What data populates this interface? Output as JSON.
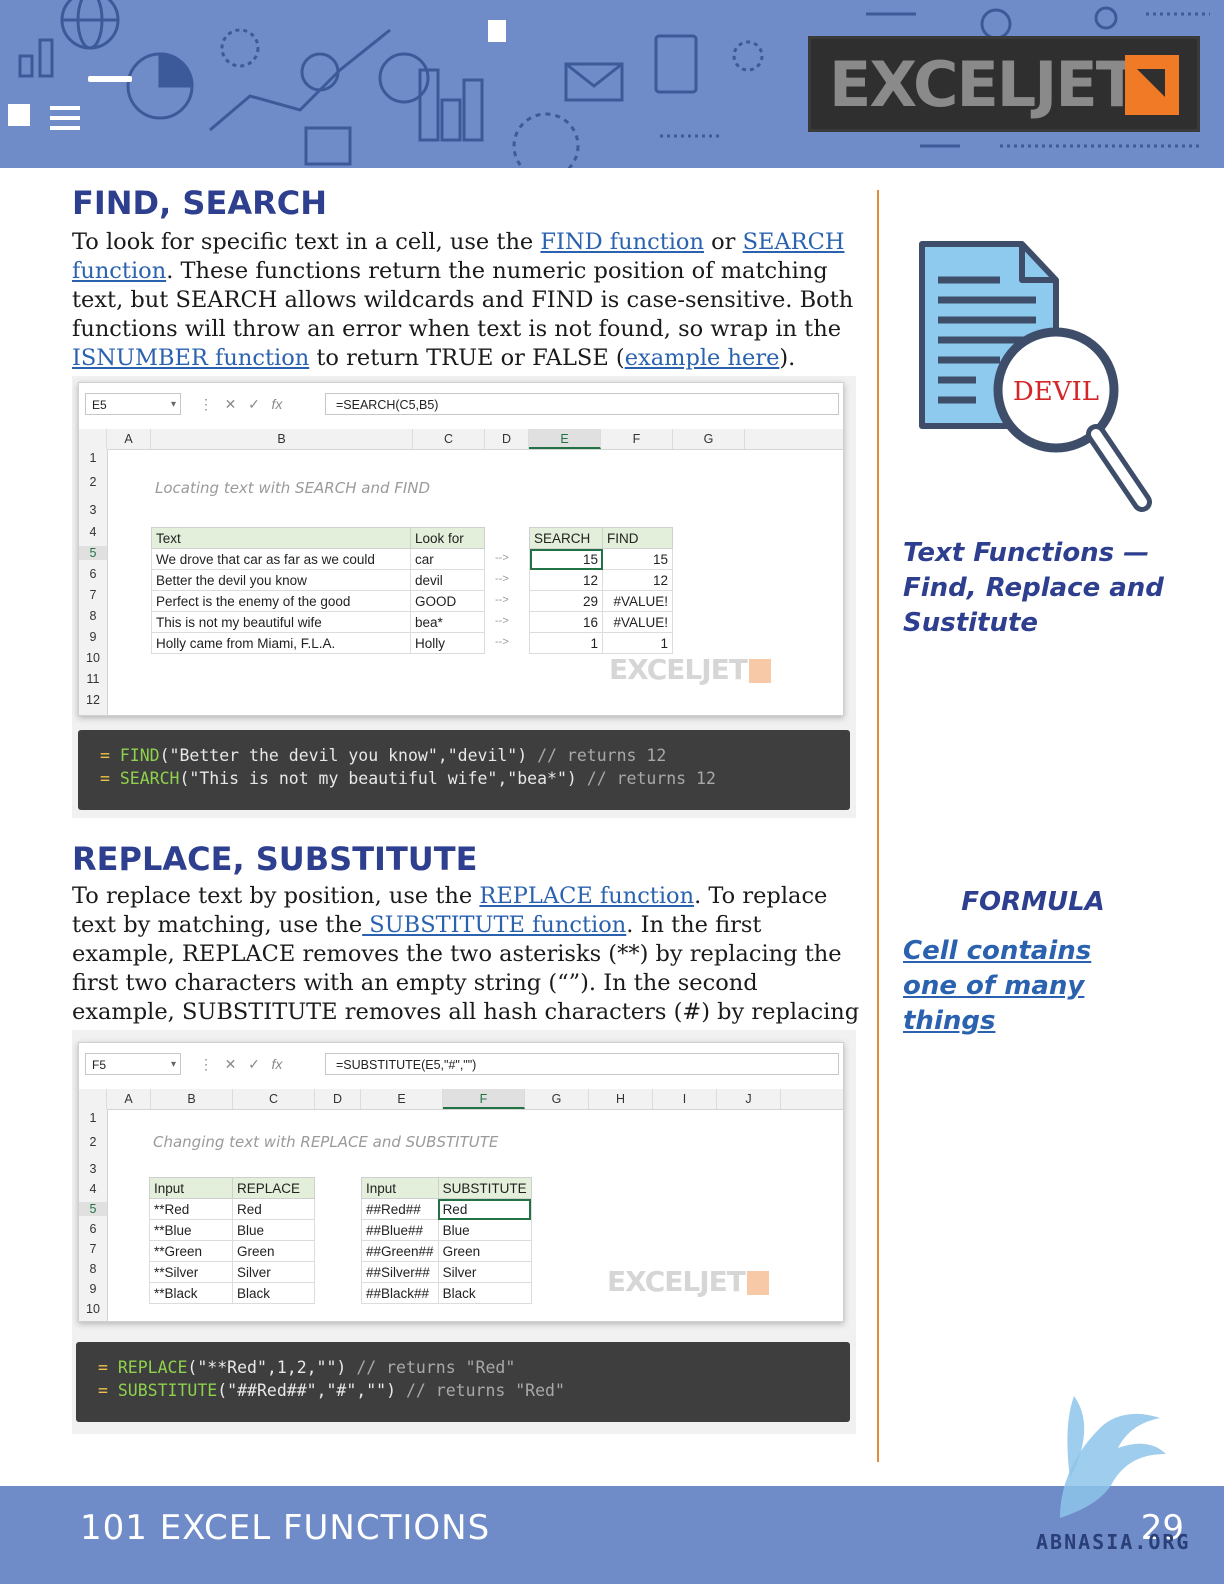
{
  "header": {
    "logo_text": "EXCELJET"
  },
  "section1": {
    "heading": "FIND, SEARCH",
    "p_a": "To look for specific text in a cell, use the ",
    "link_find": "FIND function",
    "p_b": " or ",
    "link_search": "SEARCH function",
    "p_c": ". These functions return the numeric position of matching text, but SEARCH allows wildcards and FIND is case-sensitive. Both functions will throw an error when text is not found, so wrap in the ",
    "link_isnumber": "ISNUMBER function",
    "p_d": " to return TRUE or FALSE (",
    "link_example": "example here",
    "p_e": ").",
    "sheet": {
      "namebox": "E5",
      "formula": "=SEARCH(C5,B5)",
      "columns": [
        "A",
        "B",
        "C",
        "D",
        "E",
        "F",
        "G"
      ],
      "rows": [
        "1",
        "2",
        "3",
        "4",
        "5",
        "6",
        "7",
        "8",
        "9",
        "10",
        "11",
        "12"
      ],
      "title": "Locating text with SEARCH and FIND",
      "headers": [
        "Text",
        "Look for",
        "SEARCH",
        "FIND"
      ],
      "data": [
        [
          "We drove that car as far as we could",
          "car",
          "15",
          "15"
        ],
        [
          "Better the devil you know",
          "devil",
          "12",
          "12"
        ],
        [
          "Perfect is the enemy of the good",
          "GOOD",
          "29",
          "#VALUE!"
        ],
        [
          "This is not my beautiful wife",
          "bea*",
          "16",
          "#VALUE!"
        ],
        [
          "Holly came from Miami, F.L.A.",
          "Holly",
          "1",
          "1"
        ]
      ],
      "arrow": "-->",
      "watermark": "EXCELJET"
    },
    "code": {
      "l1_fn": "FIND",
      "l1_args": "(\"Better the devil you know\",\"devil\")",
      "l1_cm": "// returns 12",
      "l2_fn": "SEARCH",
      "l2_args": "(\"This is not my beautiful wife\",\"bea*\")",
      "l2_cm": "// returns 12"
    }
  },
  "section2": {
    "heading": "REPLACE, SUBSTITUTE",
    "p_a": "To replace text by position, use the ",
    "link_replace": "REPLACE function",
    "p_b": ". To replace text by matching, use the",
    "link_substitute": " SUBSTITUTE function",
    "p_c": ". In the first example, REPLACE removes the two asterisks (**) by replacing the first two characters with an empty string (“”). In the second example, SUBSTITUTE removes all hash characters (#) by replacing “#” with “”.",
    "sheet": {
      "namebox": "F5",
      "formula": "=SUBSTITUTE(E5,\"#\",\"\")",
      "columns": [
        "A",
        "B",
        "C",
        "D",
        "E",
        "F",
        "G",
        "H",
        "I",
        "J"
      ],
      "rows": [
        "1",
        "2",
        "3",
        "4",
        "5",
        "6",
        "7",
        "8",
        "9",
        "10"
      ],
      "title": "Changing text with REPLACE and SUBSTITUTE",
      "replace_headers": [
        "Input",
        "REPLACE"
      ],
      "replace_data": [
        [
          "**Red",
          "Red"
        ],
        [
          "**Blue",
          "Blue"
        ],
        [
          "**Green",
          "Green"
        ],
        [
          "**Silver",
          "Silver"
        ],
        [
          "**Black",
          "Black"
        ]
      ],
      "sub_headers": [
        "Input",
        "SUBSTITUTE"
      ],
      "sub_data": [
        [
          "##Red##",
          "Red"
        ],
        [
          "##Blue##",
          "Blue"
        ],
        [
          "##Green##",
          "Green"
        ],
        [
          "##Silver##",
          "Silver"
        ],
        [
          "##Black##",
          "Black"
        ]
      ],
      "watermark": "EXCELJET"
    },
    "code": {
      "l1_fn": "REPLACE",
      "l1_args": "(\"**Red\",1,2,\"\")",
      "l1_cm": "// returns \"Red\"",
      "l2_fn": "SUBSTITUTE",
      "l2_args": "(\"##Red##\",\"#\",\"\")",
      "l2_cm": "// returns \"Red\""
    }
  },
  "sidebar": {
    "illustration_word": "DEVIL",
    "title": "Text Functions — Find, Replace and Sustitute",
    "formula_label": "FORMULA",
    "formula_link": "Cell contains one of many things"
  },
  "footer": {
    "title": "101 EXCEL FUNCTIONS",
    "page": "29",
    "watermark": "ABNASIA.ORG"
  },
  "colors": {
    "banner": "#6f8cc8",
    "heading": "#2d3f8e",
    "link": "#2a62b0",
    "rule": "#e38a3c",
    "logo_accent": "#f07a26"
  }
}
